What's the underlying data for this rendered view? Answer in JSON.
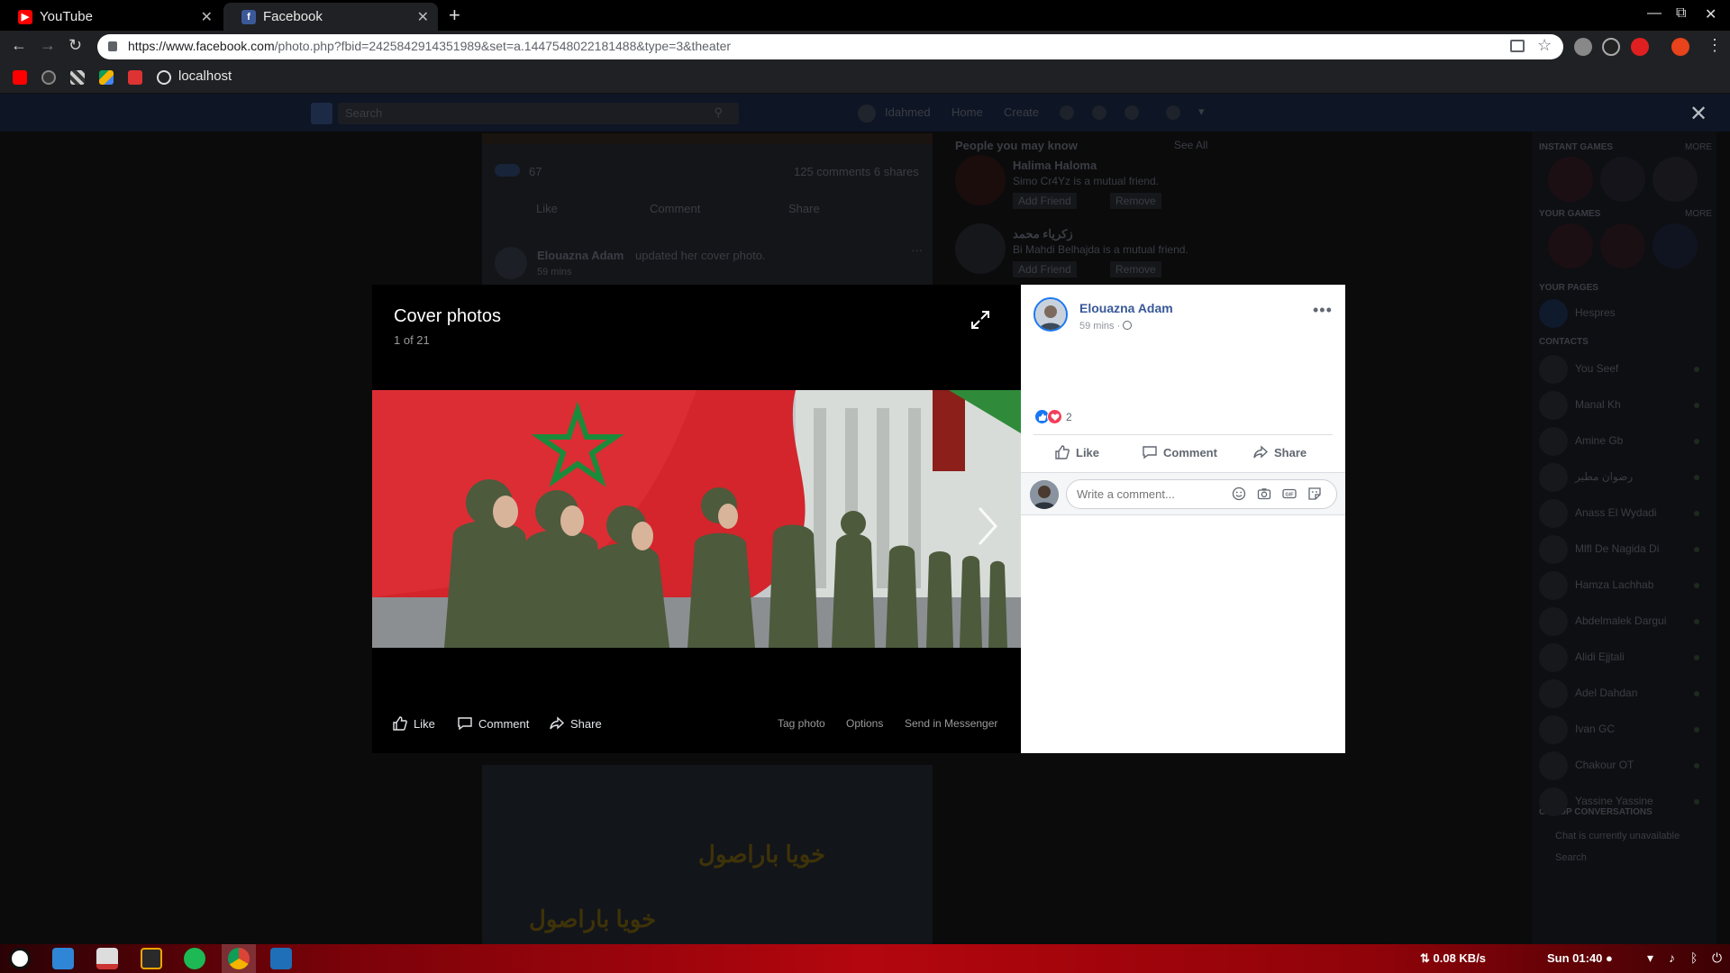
{
  "browser": {
    "tabs": [
      {
        "title": "YouTube",
        "active": false
      },
      {
        "title": "Facebook",
        "active": true
      }
    ],
    "url_origin": "https://www.facebook.com",
    "url_path": "/photo.php?fbid=2425842914351989&set=a.1447548022181488&type=3&theater",
    "bookmarks": {
      "localhost": "localhost"
    }
  },
  "background_page": {
    "search_placeholder": "Search",
    "nav": {
      "user": "Idahmed",
      "home": "Home",
      "create": "Create"
    },
    "feed": {
      "reaction_count": "67",
      "comments_shares": "125 comments  6 shares",
      "actions": [
        "Like",
        "Comment",
        "Share"
      ],
      "post_author": "Elouazna Adam",
      "post_action": "updated her cover photo.",
      "post_time": "59 mins"
    },
    "people_you_may_know": {
      "title": "People you may know",
      "see_all": "See All",
      "people": [
        {
          "name": "Halima Haloma",
          "info": "Simo Cr4Yz is a mutual friend.",
          "add": "Add Friend",
          "remove": "Remove"
        },
        {
          "name": "زكرياء محمد",
          "info": "Bi Mahdi Belhajda is a mutual friend.",
          "add": "Add Friend",
          "remove": "Remove"
        }
      ]
    },
    "right_rail": {
      "instant_games": "INSTANT GAMES",
      "your_games": "YOUR GAMES",
      "more": "MORE",
      "your_pages": "YOUR PAGES",
      "page_name": "Hespres",
      "contacts_title": "CONTACTS",
      "contacts": [
        "You Seef",
        "Manal Kh",
        "Amine Gb",
        "رضوان مطير",
        "Anass El Wydadi",
        "Mlfl De Nagida Di",
        "Hamza Lachhab",
        "Abdelmalek Dargui",
        "Alidi Ejjtali",
        "Adel Dahdan",
        "Ivan GC",
        "Chakour OT",
        "Yassine Yassine"
      ],
      "group_conversations": "GROUP CONVERSATIONS",
      "chat_unavailable": "Chat is currently unavailable",
      "chat_search": "Search"
    }
  },
  "theater": {
    "album_title": "Cover photos",
    "counter": "1 of 21",
    "actions": {
      "like": "Like",
      "comment": "Comment",
      "share": "Share"
    },
    "links": {
      "tag": "Tag photo",
      "options": "Options",
      "messenger": "Send in Messenger"
    },
    "meme_text": "خويا باراصول"
  },
  "side_panel": {
    "author": "Elouazna Adam",
    "time": "59 mins",
    "privacy_icon": "globe-icon",
    "reaction_count": "2",
    "actions": {
      "like": "Like",
      "comment": "Comment",
      "share": "Share"
    },
    "comment_placeholder": "Write a comment..."
  },
  "taskbar": {
    "net_speed": "⇅ 0.08 KB/s",
    "clock": "Sun 01:40 ●"
  },
  "colors": {
    "fb_blue": "#385898",
    "like_blue": "#1877f2",
    "love_red": "#f33e58",
    "taskbar_red": "#b4060e"
  }
}
